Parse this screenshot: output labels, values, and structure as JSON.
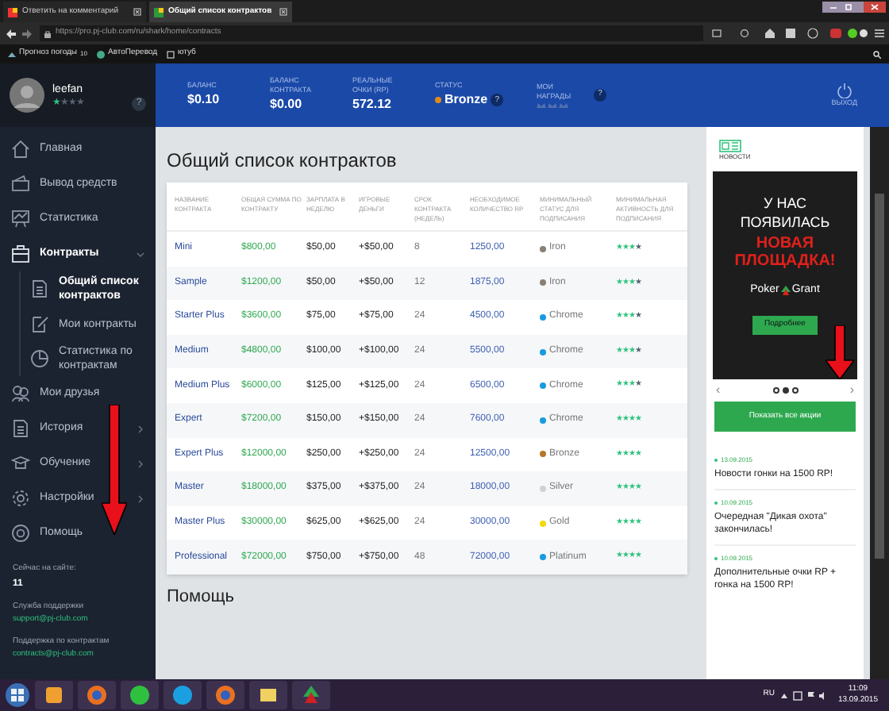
{
  "browser": {
    "tabs": [
      {
        "label": "Ответить на комментарий",
        "selected": false
      },
      {
        "label": "Общий список контрактов",
        "selected": true
      }
    ],
    "url": "https://pro.pj-club.com/ru/shark/home/contracts",
    "bookmarks": [
      {
        "label": "Прогноз погоды",
        "count": "10"
      },
      {
        "label": "АвтоПеревод"
      },
      {
        "label": "ютуб"
      }
    ]
  },
  "user": {
    "name": "leefan",
    "stars": 1,
    "help": "?"
  },
  "header": {
    "stats": [
      {
        "label": "БАЛАНС",
        "value": "$0.10"
      },
      {
        "label": "БАЛАНС КОНТРАКТА",
        "value": "$0.00"
      },
      {
        "label": "РЕАЛЬНЫЕ ОЧКИ (RP)",
        "value": "572.12"
      }
    ],
    "status": {
      "label": "СТАТУС",
      "value": "Bronze",
      "color": "#e08a1a",
      "help": "?"
    },
    "awards": {
      "label": "МОИ НАГРАДЫ",
      "help": "?"
    },
    "logout": "ВЫХОД"
  },
  "sidebar": {
    "items": [
      {
        "label": "Главная"
      },
      {
        "label": "Вывод средств"
      },
      {
        "label": "Статистика"
      },
      {
        "label": "Контракты",
        "expanded": true,
        "children": [
          {
            "label": "Общий список контрактов",
            "selected": true
          },
          {
            "label": "Мои контракты",
            "selected": false
          },
          {
            "label": "Статистика по контрактам",
            "selected": false
          }
        ]
      },
      {
        "label": "Мои друзья"
      },
      {
        "label": "История",
        "expanded": false
      },
      {
        "label": "Обучение",
        "expanded": false
      },
      {
        "label": "Настройки",
        "expanded": false
      },
      {
        "label": "Помощь"
      }
    ],
    "online_label": "Сейчас на сайте:",
    "online_count": "11",
    "contacts": [
      {
        "label": "Служба поддержки",
        "email": "support@pj-club.com"
      },
      {
        "label": "Поддержка по контрактам",
        "email": "contracts@pj-club.com"
      }
    ]
  },
  "main": {
    "title": "Общий список контрактов",
    "table": {
      "columns": [
        "НАЗВАНИЕ КОНТРАКТА",
        "ОБЩАЯ СУММА ПО КОНТРАКТУ",
        "ЗАРПЛАТА В НЕДЕЛЮ",
        "ИГРОВЫЕ ДЕНЬГИ",
        "СРОК КОНТРАКТА (НЕДЕЛЬ)",
        "НЕОБХОДИМОЕ КОЛИЧЕСТВО RP",
        "МИНИМАЛЬНЫЙ СТАТУС ДЛЯ ПОДПИСАНИЯ",
        "МИНИМАЛЬНАЯ АКТИВНОСТЬ ДЛЯ ПОДПИСАНИЯ"
      ],
      "rows": [
        {
          "name": "Mini",
          "total": "$800,00",
          "weekly": "$50,00",
          "game_money": "+$50,00",
          "weeks": "8",
          "rp": "1250,00",
          "status": "Iron",
          "color": "#8a7f74",
          "stars": 3
        },
        {
          "name": "Sample",
          "total": "$1200,00",
          "weekly": "$50,00",
          "game_money": "+$50,00",
          "weeks": "12",
          "rp": "1875,00",
          "status": "Iron",
          "color": "#8a7f74",
          "stars": 3
        },
        {
          "name": "Starter Plus",
          "total": "$3600,00",
          "weekly": "$75,00",
          "game_money": "+$75,00",
          "weeks": "24",
          "rp": "4500,00",
          "status": "Chrome",
          "color": "#1a9be0",
          "stars": 3
        },
        {
          "name": "Medium",
          "total": "$4800,00",
          "weekly": "$100,00",
          "game_money": "+$100,00",
          "weeks": "24",
          "rp": "5500,00",
          "status": "Chrome",
          "color": "#1a9be0",
          "stars": 3
        },
        {
          "name": "Medium Plus",
          "total": "$6000,00",
          "weekly": "$125,00",
          "game_money": "+$125,00",
          "weeks": "24",
          "rp": "6500,00",
          "status": "Chrome",
          "color": "#1a9be0",
          "stars": 3
        },
        {
          "name": "Expert",
          "total": "$7200,00",
          "weekly": "$150,00",
          "game_money": "+$150,00",
          "weeks": "24",
          "rp": "7600,00",
          "status": "Chrome",
          "color": "#1a9be0",
          "stars": 4
        },
        {
          "name": "Expert Plus",
          "total": "$12000,00",
          "weekly": "$250,00",
          "game_money": "+$250,00",
          "weeks": "24",
          "rp": "12500,00",
          "status": "Bronze",
          "color": "#b8752a",
          "stars": 4
        },
        {
          "name": "Master",
          "total": "$18000,00",
          "weekly": "$375,00",
          "game_money": "+$375,00",
          "weeks": "24",
          "rp": "18000,00",
          "status": "Silver",
          "color": "#cfd2d6",
          "stars": 4
        },
        {
          "name": "Master Plus",
          "total": "$30000,00",
          "weekly": "$625,00",
          "game_money": "+$625,00",
          "weeks": "24",
          "rp": "30000,00",
          "status": "Gold",
          "color": "#f5d90a",
          "stars": 4
        },
        {
          "name": "Professional",
          "total": "$72000,00",
          "weekly": "$750,00",
          "game_money": "+$750,00",
          "weeks": "48",
          "rp": "72000,00",
          "status": "Platinum",
          "color": "#1a9be0",
          "stars": 4
        }
      ]
    },
    "help_title": "Помощь"
  },
  "news_panel": {
    "tab": "НОВОСТИ",
    "banner": {
      "line1": "У НАС ПОЯВИЛАСЬ",
      "line2": "НОВАЯ ПЛОЩАДКА!",
      "brand_left": "Poker",
      "brand_right": "Grant",
      "button": "Подробнее"
    },
    "prev": "‹",
    "next": "›",
    "dots": [
      {
        "selected": false
      },
      {
        "selected": true
      },
      {
        "selected": false
      }
    ],
    "show_all": "Показать все акции",
    "news": [
      {
        "date": "13.09.2015",
        "title": "Новости гонки на 1500 RP!"
      },
      {
        "date": "10.09.2015",
        "title": "Очередная \"Дикая охота\" закончилась!"
      },
      {
        "date": "10.09.2015",
        "title": "Дополнительные очки RP + гонка на 1500 RP!"
      }
    ]
  },
  "taskbar": {
    "language": "RU",
    "time": "11:09",
    "date": "13.09.2015"
  }
}
